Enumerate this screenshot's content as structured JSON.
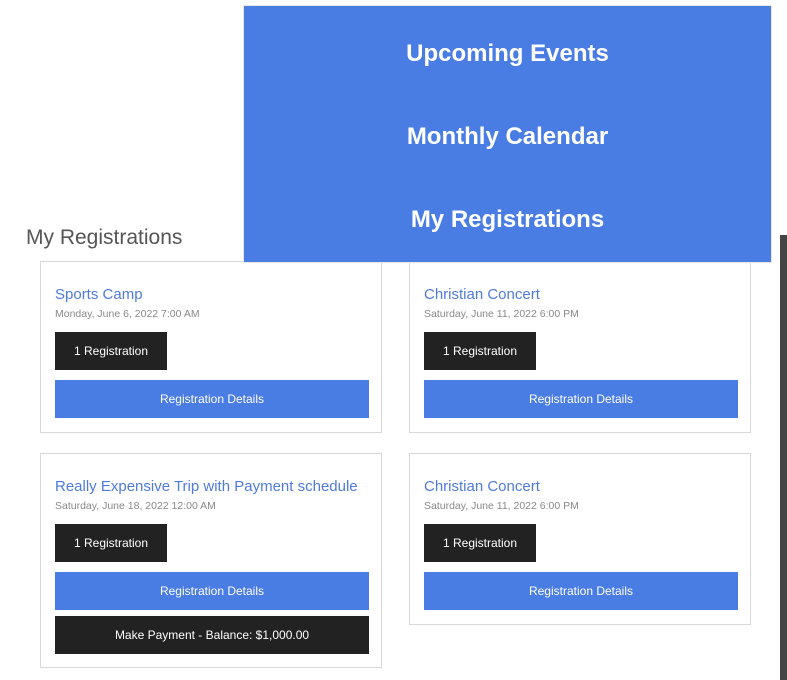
{
  "page": {
    "heading": "My Registrations"
  },
  "nav": {
    "items": [
      {
        "label": "Upcoming Events"
      },
      {
        "label": "Monthly Calendar"
      },
      {
        "label": "My Registrations"
      }
    ]
  },
  "registrations": [
    {
      "title": "Sports Camp",
      "date": "Monday, June 6, 2022 7:00 AM",
      "count": "1 Registration",
      "details": "Registration Details"
    },
    {
      "title": "Christian Concert",
      "date": "Saturday, June 11, 2022 6:00 PM",
      "count": "1 Registration",
      "details": "Registration Details"
    },
    {
      "title": "Really Expensive Trip with Payment schedule",
      "date": "Saturday, June 18, 2022 12:00 AM",
      "count": "1 Registration",
      "details": "Registration Details",
      "payment": "Make Payment - Balance: $1,000.00"
    },
    {
      "title": "Christian Concert",
      "date": "Saturday, June 11, 2022 6:00 PM",
      "count": "1 Registration",
      "details": "Registration Details"
    }
  ],
  "colors": {
    "accent": "#4a7de4",
    "dark_button": "#222222",
    "title_link": "#4f7bdc"
  }
}
